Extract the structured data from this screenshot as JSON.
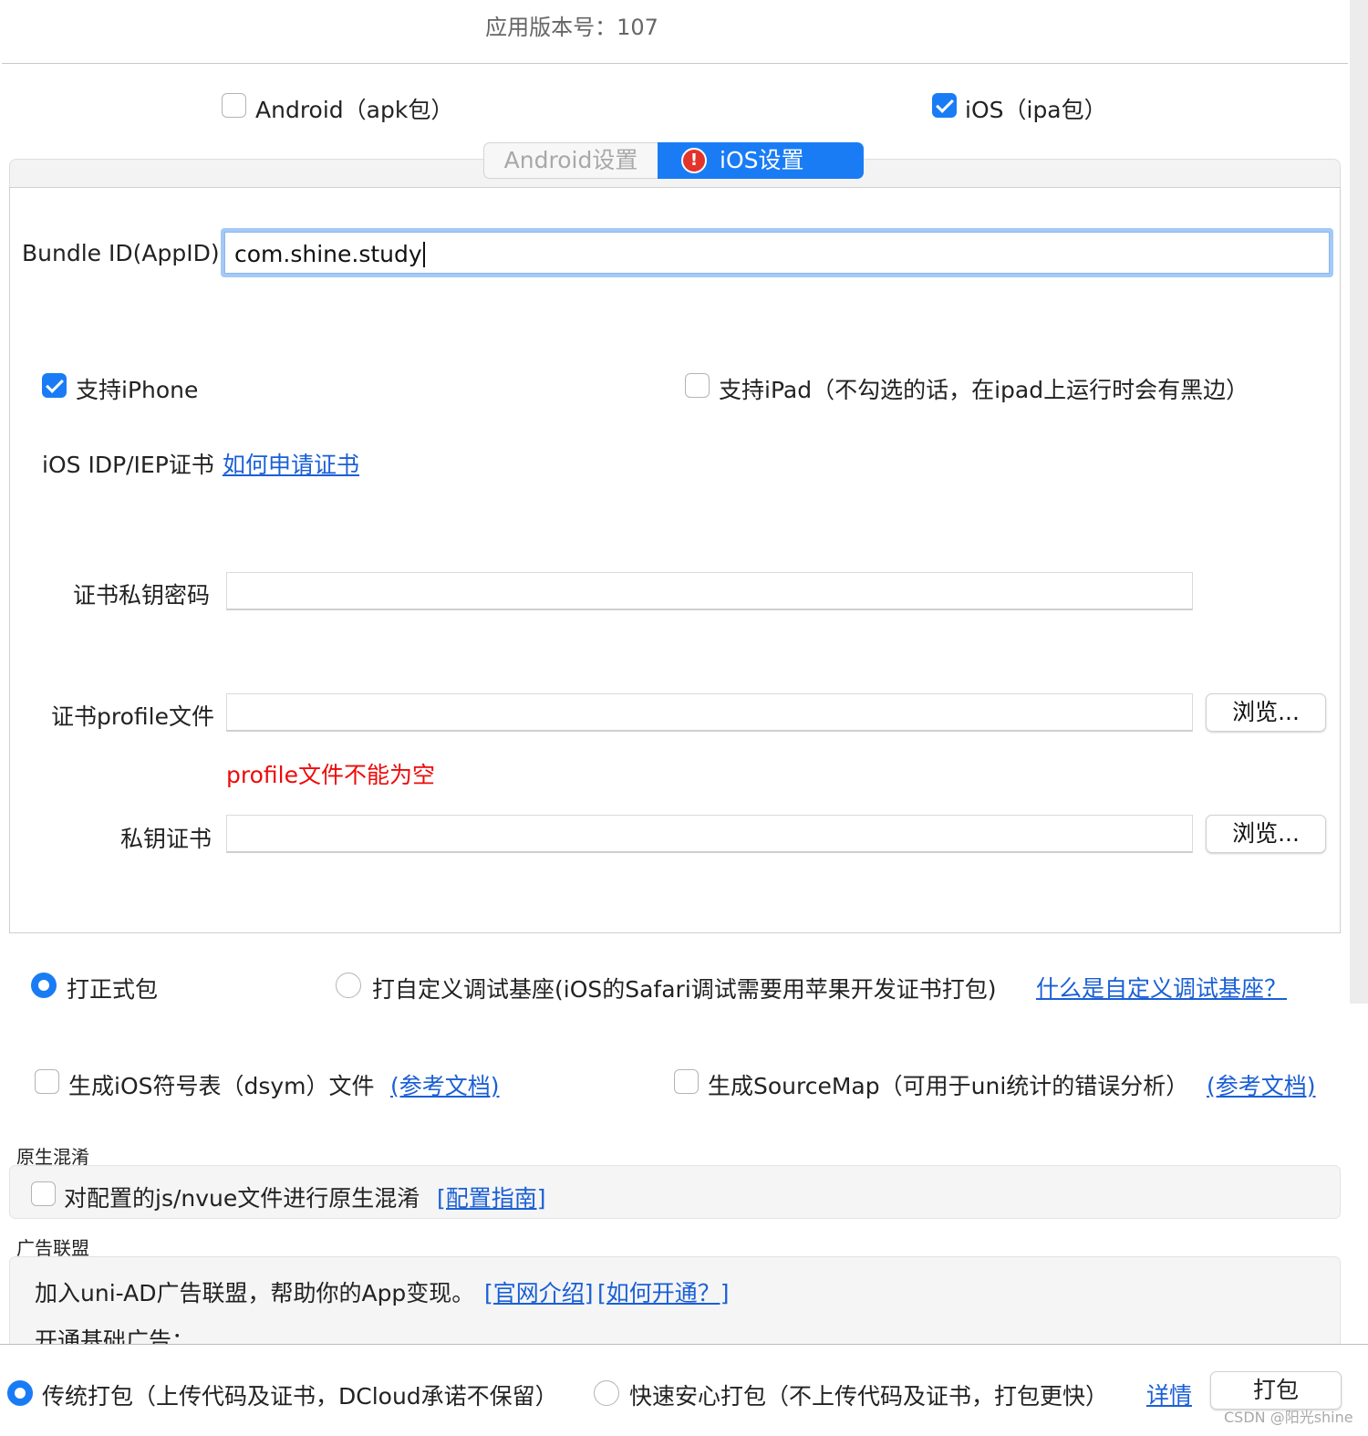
{
  "header": {
    "version_text": "应用版本号：107"
  },
  "platforms": {
    "android_label": "Android（apk包）",
    "android_checked": false,
    "ios_label": "iOS（ipa包）",
    "ios_checked": true
  },
  "tabs": {
    "android": "Android设置",
    "ios": "iOS设置",
    "ios_warning_icon": "warning-icon"
  },
  "ios_settings": {
    "bundle_label": "Bundle ID(AppID)",
    "bundle_value": "com.shine.study",
    "support_iphone_label": "支持iPhone",
    "support_iphone_checked": true,
    "support_ipad_label": "支持iPad（不勾选的话，在ipad上运行时会有黑边）",
    "support_ipad_checked": false,
    "cert_heading": "iOS IDP/IEP证书",
    "cert_link": "如何申请证书",
    "cert_password_label": "证书私钥密码",
    "profile_label": "证书profile文件",
    "profile_error": "profile文件不能为空",
    "private_key_label": "私钥证书",
    "browse_label": "浏览..."
  },
  "build_type": {
    "release_label": "打正式包",
    "release_selected": true,
    "custom_base_label": "打自定义调试基座(iOS的Safari调试需要用苹果开发证书打包)",
    "custom_base_selected": false,
    "custom_base_link": "什么是自定义调试基座？"
  },
  "options": {
    "dsym_label": "生成iOS符号表（dsym）文件",
    "dsym_link": "(参考文档)",
    "sourcemap_label": "生成SourceMap（可用于uni统计的错误分析）",
    "sourcemap_link": "(参考文档)"
  },
  "obfuscation": {
    "title": "原生混淆",
    "label": "对配置的js/nvue文件进行原生混淆",
    "link": "[配置指南]"
  },
  "ads": {
    "title": "广告联盟",
    "text": "加入uni-AD广告联盟，帮助你的App变现。",
    "link_official": "[官网介绍]",
    "link_howto": "[如何开通？]",
    "basic_ads": "开通基础广告："
  },
  "footer": {
    "traditional_label": "传统打包（上传代码及证书，DCloud承诺不保留）",
    "traditional_selected": true,
    "fast_label": "快速安心打包（不上传代码及证书，打包更快）",
    "fast_selected": false,
    "details_link": "详情",
    "pack_button": "打包",
    "watermark": "CSDN @阳光shine"
  },
  "colors": {
    "accent": "#1a7cf5",
    "link": "#1a5fd6",
    "error": "#ee0a0a"
  }
}
